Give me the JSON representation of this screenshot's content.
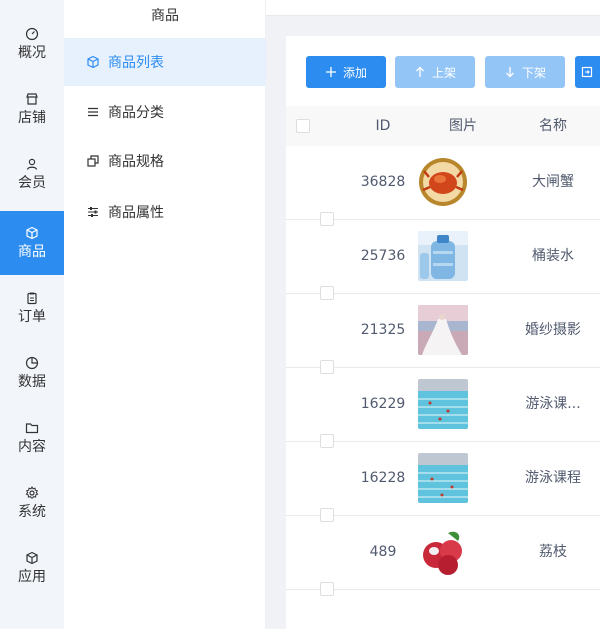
{
  "rail": {
    "items": [
      {
        "label": "概况",
        "icon": "dashboard-icon"
      },
      {
        "label": "店铺",
        "icon": "store-icon"
      },
      {
        "label": "会员",
        "icon": "user-icon"
      },
      {
        "label": "商品",
        "icon": "box-icon"
      },
      {
        "label": "订单",
        "icon": "clipboard-icon"
      },
      {
        "label": "数据",
        "icon": "pie-chart-icon"
      },
      {
        "label": "内容",
        "icon": "folder-icon"
      },
      {
        "label": "系统",
        "icon": "gear-icon"
      },
      {
        "label": "应用",
        "icon": "cube-icon"
      }
    ],
    "active_index": 3,
    "active_color": "#2d8cf0"
  },
  "submenu": {
    "title": "商品",
    "items": [
      {
        "label": "商品列表",
        "icon": "box-icon"
      },
      {
        "label": "商品分类",
        "icon": "list-icon"
      },
      {
        "label": "商品规格",
        "icon": "copy-icon"
      },
      {
        "label": "商品属性",
        "icon": "sliders-icon"
      }
    ],
    "active_index": 0
  },
  "toolbar": {
    "add_label": "添加",
    "on_shelf_label": "上架",
    "off_shelf_label": "下架"
  },
  "table": {
    "columns": [
      "ID",
      "图片",
      "名称"
    ],
    "rows": [
      {
        "id": "36828",
        "name": "大闸蟹",
        "image": "crab"
      },
      {
        "id": "25736",
        "name": "桶装水",
        "image": "water-bottle"
      },
      {
        "id": "21325",
        "name": "婚纱摄影",
        "image": "wedding-photo"
      },
      {
        "id": "16229",
        "name": "游泳课...",
        "image": "swimming-pool"
      },
      {
        "id": "16228",
        "name": "游泳课程",
        "image": "swimming-pool"
      },
      {
        "id": "489",
        "name": "荔枝",
        "image": "lychee"
      }
    ]
  }
}
